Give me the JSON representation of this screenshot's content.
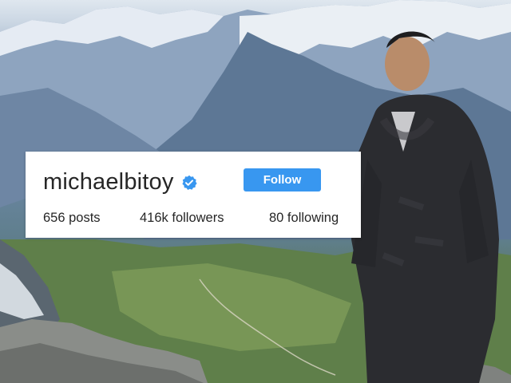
{
  "profile": {
    "username": "michaelbitoy",
    "verified_icon": "verified-badge-icon",
    "follow_label": "Follow",
    "stats": {
      "posts": "656 posts",
      "followers": "416k followers",
      "following": "80 following"
    }
  },
  "colors": {
    "accent": "#3897f0",
    "text": "#262626",
    "card_background": "#ffffff"
  }
}
